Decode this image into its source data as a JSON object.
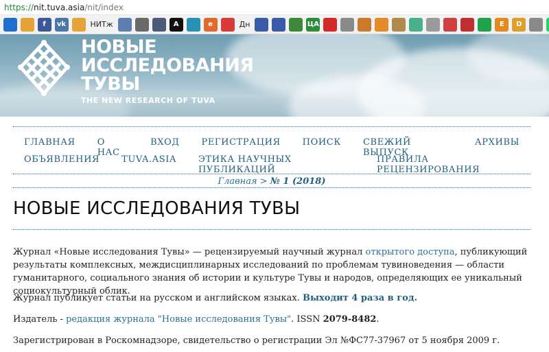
{
  "browser": {
    "url_protocol": "https://",
    "url_host": "nit.tuva.asia",
    "url_path": "/nit/index",
    "bookmarks": [
      {
        "icon": "four-squares-icon",
        "label": "",
        "color": "#1e6fd0"
      },
      {
        "icon": "diamond-icon",
        "label": "",
        "color": "#e5a33a"
      },
      {
        "icon": "facebook-icon",
        "label": "f",
        "color": "#3b5998"
      },
      {
        "icon": "vk-icon",
        "label": "vk",
        "color": "#4a76a8"
      },
      {
        "icon": "diamond-icon",
        "label": "",
        "color": "#e5a33a"
      },
      {
        "icon": "nitzh-text",
        "label": "НИТж",
        "color": ""
      },
      {
        "icon": "shield-icon",
        "label": "",
        "color": "#5d7fb0"
      },
      {
        "icon": "library-icon",
        "label": "",
        "color": "#6a6a6a"
      },
      {
        "icon": "building-icon",
        "label": "",
        "color": "#4a5a7a"
      },
      {
        "icon": "letter-a-icon",
        "label": "A",
        "color": "#111111"
      },
      {
        "icon": "wave-icon",
        "label": "",
        "color": "#2a90b5"
      },
      {
        "icon": "e-circle-icon",
        "label": "e",
        "color": "#e06a2c"
      },
      {
        "icon": "speech-icon",
        "label": "",
        "color": "#d93a3a"
      },
      {
        "icon": "dn-text",
        "label": "Дн",
        "color": ""
      },
      {
        "icon": "emblem-icon",
        "label": "",
        "color": "#3a5ba8"
      },
      {
        "icon": "emblem-icon",
        "label": "",
        "color": "#3a5ba8"
      },
      {
        "icon": "books-icon",
        "label": "",
        "color": "#3d8a3d"
      },
      {
        "icon": "tsa-icon",
        "label": "ЦА",
        "color": "#2d8c3c"
      },
      {
        "icon": "flag-icon",
        "label": "",
        "color": "#d22a2a"
      },
      {
        "icon": "page-icon",
        "label": "",
        "color": "#8a8a8a"
      },
      {
        "icon": "grid-icon",
        "label": "",
        "color": "#c97a2a"
      },
      {
        "icon": "orange-circle-icon",
        "label": "",
        "color": "#e58a2a"
      },
      {
        "icon": "seal-icon",
        "label": "",
        "color": "#b08a4a"
      },
      {
        "icon": "shield-icon",
        "label": "",
        "color": "#4ab08a"
      },
      {
        "icon": "doc-icon",
        "label": "",
        "color": "#9a9a9a"
      },
      {
        "icon": "magnet-icon",
        "label": "",
        "color": "#d04040"
      },
      {
        "icon": "link-icon",
        "label": "",
        "color": "#c03030"
      },
      {
        "icon": "sber-icon",
        "label": "",
        "color": "#23a24d"
      },
      {
        "icon": "letter-e-icon",
        "label": "E",
        "color": "#e08a20"
      },
      {
        "icon": "d-box-icon",
        "label": "D",
        "color": "#e0a030"
      },
      {
        "icon": "pen-icon",
        "label": "",
        "color": "#8a8a8a"
      },
      {
        "icon": "whatsapp-icon",
        "label": "",
        "color": "#25d366"
      },
      {
        "icon": "swirl-icon",
        "label": "",
        "color": "#3a9ad9"
      },
      {
        "icon": "doc-icon",
        "label": "",
        "color": "#6a6a6a"
      },
      {
        "icon": "globe-icon",
        "label": "",
        "color": "#3a7ad9"
      }
    ]
  },
  "banner": {
    "title_line1": "НОВЫЕ",
    "title_line2": "ИССЛЕДОВАНИЯ",
    "title_line3": "ТУВЫ",
    "subtitle": "THE NEW RESEARCH OF TUVA"
  },
  "nav": {
    "row1": [
      "ГЛАВНАЯ",
      "О НАС",
      "ВХОД",
      "РЕГИСТРАЦИЯ",
      "ПОИСК",
      "СВЕЖИЙ ВЫПУСК",
      "АРХИВЫ"
    ],
    "row2": [
      "ОБЪЯВЛЕНИЯ",
      "TUVA.ASIA",
      "ЭТИКА НАУЧНЫХ ПУБЛИКАЦИЙ",
      "ПРАВИЛА РЕЦЕНЗИРОВАНИЯ"
    ]
  },
  "breadcrumb": {
    "home": "Главная",
    "separator": " > ",
    "current": "№ 1 (2018)"
  },
  "page": {
    "heading": "НОВЫЕ ИССЛЕДОВАНИЯ ТУВЫ",
    "p1_a": "Журнал «Новые исследования Тувы» — рецензируемый научный журнал ",
    "p1_link": "открытого доступа",
    "p1_b": ", публикующий результаты комплексных, междисциплинарных исследований по проблемам тувиноведения — области гуманитарного, социального знания об истории и культуре Тувы и народов, определяющих ее уникальный социокультурный облик.",
    "p2_a": "Журнал публикует статьи на русском и английском языках. ",
    "p2_bold": "Выходит 4 раза в год.",
    "p3_a": "Издатель - ",
    "p3_link": "редакция журнала \"Новые исследования Тувы\"",
    "p3_b": ". ISSN ",
    "p3_issn": "2079-8482",
    "p3_c": ".",
    "p4": "Зарегистрирован в Роскомнадзоре, свидетельство о регистрации Эл №ФС77-37967 от 5 ноября 2009 г."
  }
}
